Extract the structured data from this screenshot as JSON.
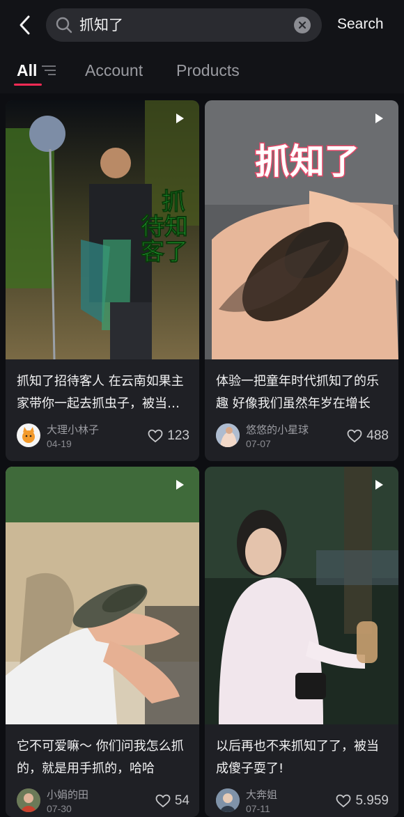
{
  "header": {
    "query": "抓知了",
    "search_label": "Search"
  },
  "tabs": [
    {
      "label": "All",
      "active": true
    },
    {
      "label": "Account",
      "active": false
    },
    {
      "label": "Products",
      "active": false
    }
  ],
  "colors": {
    "accent": "#ff2b55",
    "background": "#121317",
    "card": "#1f2025"
  },
  "results": [
    {
      "title": "抓知了招待客人 在云南如果主家带你一起去抓虫子，被当成自己人了",
      "author": "大理小林子",
      "date": "04-19",
      "likes": "123",
      "thumb_overlay": "抓知了待客",
      "is_video": true
    },
    {
      "title": "体验一把童年时代抓知了的乐趣 好像我们虽然年岁在增长",
      "author": "悠悠的小星球",
      "date": "07-07",
      "likes": "488",
      "thumb_overlay": "抓知了",
      "is_video": true
    },
    {
      "title": "它不可爱嘛～ 你们问我怎么抓的，就是用手抓的，哈哈",
      "author": "小娟的田",
      "date": "07-30",
      "likes": "54",
      "is_video": true
    },
    {
      "title": "以后再也不来抓知了了，被当成傻子耍了!",
      "author": "大奔姐",
      "date": "07-11",
      "likes": "5.959",
      "is_video": true
    }
  ]
}
